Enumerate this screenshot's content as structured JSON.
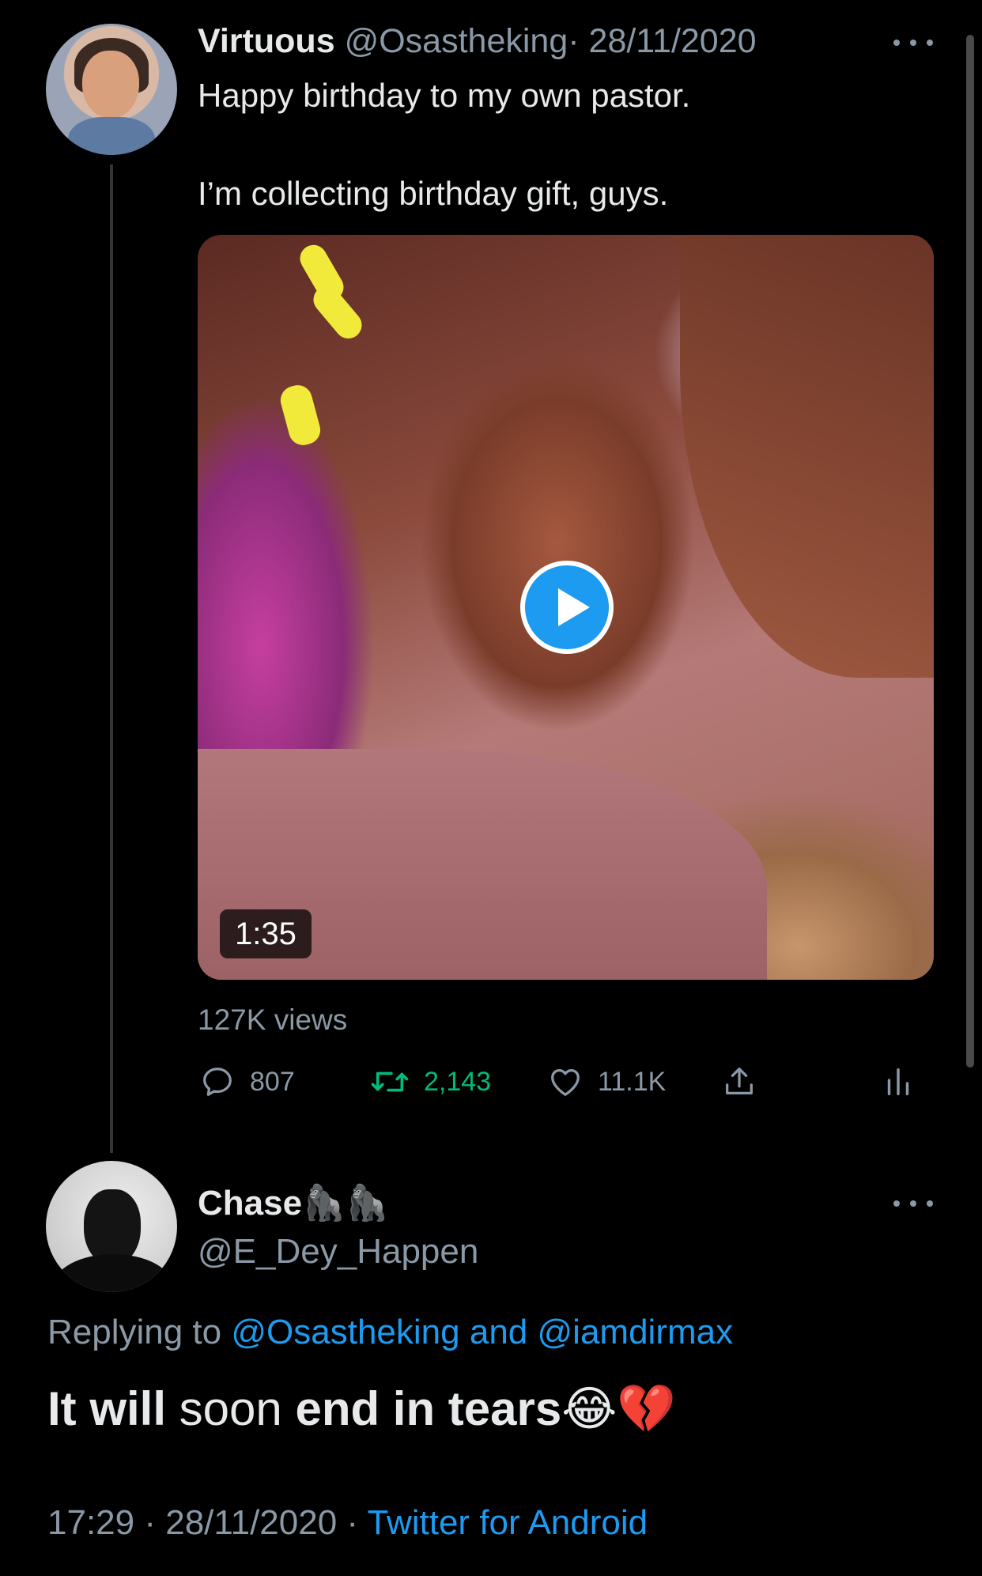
{
  "tweet": {
    "author_name": "Virtuous",
    "author_handle": "@Osastheking",
    "date_separator": "·",
    "date": "28/11/2020",
    "text_line1": "Happy birthday to my own pastor.",
    "text_line2": "I’m collecting birthday gift, guys.",
    "video_duration": "1:35",
    "views": "127K views",
    "actions": {
      "replies": "807",
      "retweets": "2,143",
      "likes": "11.1K"
    },
    "colors": {
      "retweet_active": "#00ba7c",
      "muted": "#8b98a5",
      "accent": "#1d9bf0"
    },
    "icons": [
      "more-icon",
      "play-icon",
      "reply-icon",
      "retweet-icon",
      "like-icon",
      "share-icon",
      "analytics-icon"
    ]
  },
  "reply": {
    "author_name": "Chase🦍🦍",
    "author_handle": "@E_Dey_Happen",
    "replying_prefix": "Replying to",
    "replying_user1": "@Osastheking",
    "replying_and": "and",
    "replying_user2": "@iamdirmax",
    "text_part1": "It will",
    "text_part2": "soon",
    "text_part3": "end in tears😂💔",
    "time": "17:29",
    "meta_separator": "·",
    "date": "28/11/2020",
    "source": "Twitter for Android"
  }
}
